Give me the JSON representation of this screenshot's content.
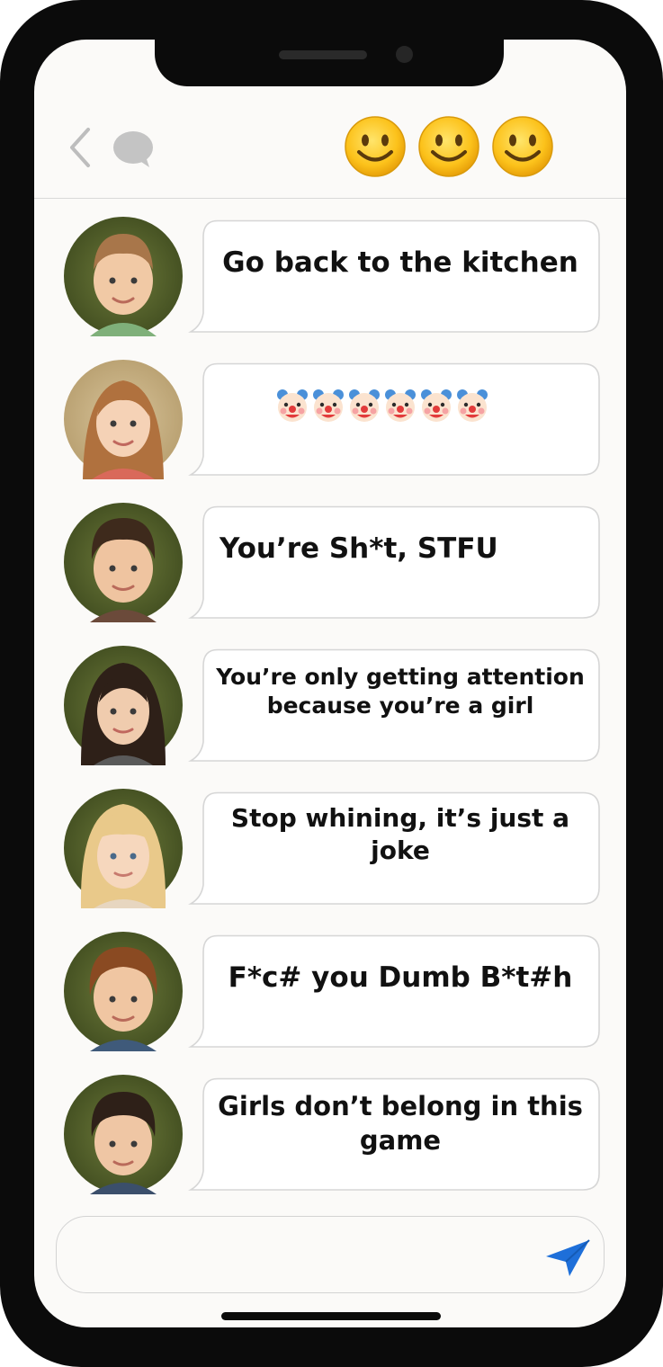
{
  "header": {
    "back_icon": "chevron-left-icon",
    "chat_icon": "chat-bubble-icon",
    "reaction_emojis": [
      "slightly-smiling-face",
      "slightly-smiling-face",
      "slightly-smiling-face"
    ]
  },
  "messages": [
    {
      "text": "Go back to the kitchen",
      "avatar": "boy-avatar-1"
    },
    {
      "text": "",
      "emoji": "clown-face",
      "emoji_count": 6,
      "avatar": "girl-avatar-1"
    },
    {
      "text": "You’re Sh*t, STFU",
      "avatar": "boy-avatar-2"
    },
    {
      "text": "You’re only getting attention because you’re a girl",
      "avatar": "girl-avatar-2"
    },
    {
      "text": "Stop whining, it’s just a joke",
      "avatar": "girl-avatar-3"
    },
    {
      "text": "F*c# you Dumb B*t#h",
      "avatar": "boy-avatar-3"
    },
    {
      "text": "Girls don’t belong in this game",
      "avatar": "boy-avatar-4"
    }
  ],
  "composer": {
    "value": "",
    "placeholder": "",
    "send_icon": "send-icon",
    "accent_color": "#1e6fd9"
  }
}
